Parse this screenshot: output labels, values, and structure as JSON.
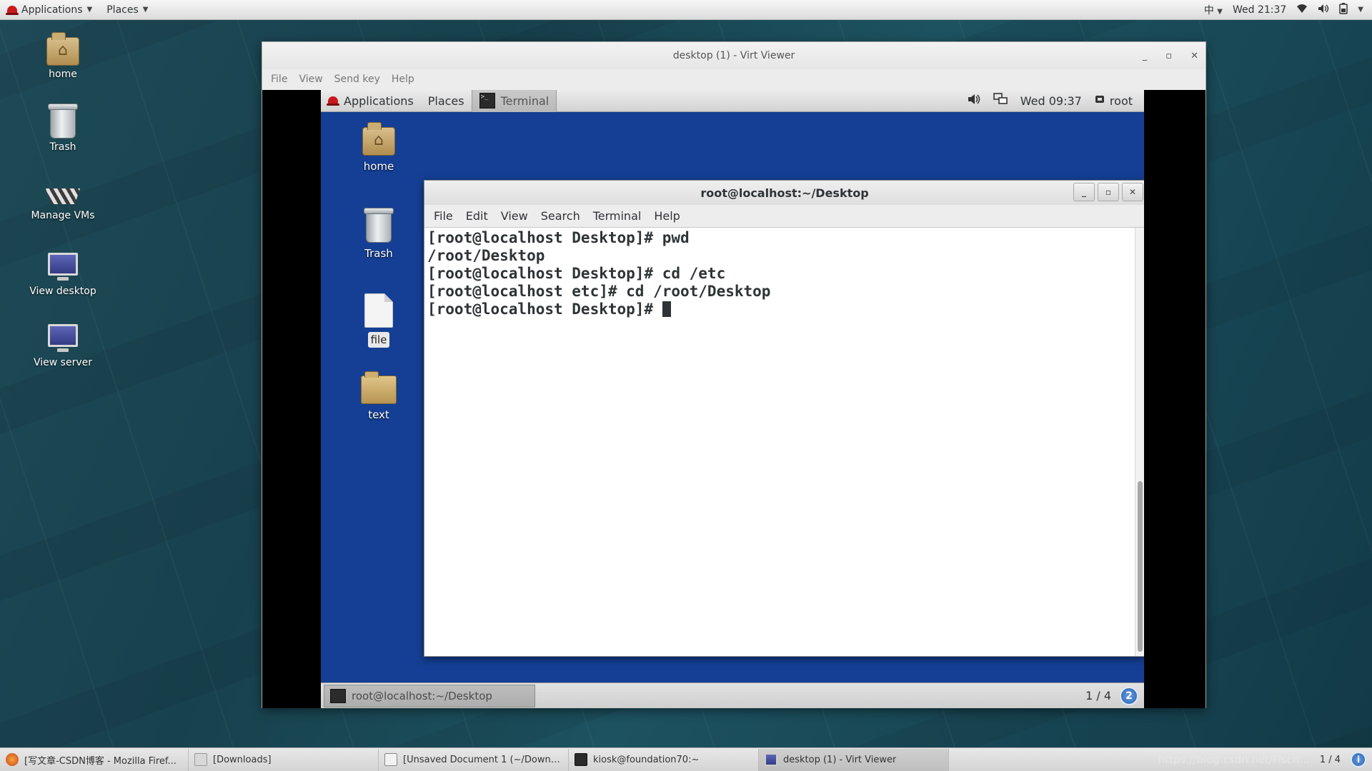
{
  "host_panel": {
    "applications": "Applications",
    "places": "Places",
    "input_method": "中",
    "clock": "Wed 21:37"
  },
  "host_desktop": {
    "icons": [
      "home",
      "Trash",
      "Manage VMs",
      "View desktop",
      "View server"
    ]
  },
  "virt_viewer": {
    "title": "desktop (1) - Virt Viewer",
    "menu": [
      "File",
      "View",
      "Send key",
      "Help"
    ]
  },
  "guest_panel": {
    "applications": "Applications",
    "places": "Places",
    "terminal_tab": "Terminal",
    "clock": "Wed 09:37",
    "user": "root"
  },
  "guest_desktop": {
    "icons": [
      "home",
      "Trash",
      "file",
      "text"
    ]
  },
  "terminal": {
    "title": "root@localhost:~/Desktop",
    "menu": [
      "File",
      "Edit",
      "View",
      "Search",
      "Terminal",
      "Help"
    ],
    "lines": [
      "[root@localhost Desktop]# pwd",
      "/root/Desktop",
      "[root@localhost Desktop]# cd /etc",
      "[root@localhost etc]# cd /root/Desktop",
      "[root@localhost Desktop]# "
    ]
  },
  "guest_bottom": {
    "task": "root@localhost:~/Desktop",
    "pager": "1 / 4",
    "help_badge": "2"
  },
  "host_taskbar": {
    "items": [
      "[写文章-CSDN博客 - Mozilla Firef...",
      "[Downloads]",
      "[Unsaved Document 1 (~/Downlo...",
      "kiosk@foundation70:~",
      "desktop (1) - Virt Viewer"
    ],
    "watermark": "https://blog.csdn.net/Fisch...",
    "pager": "1 / 4"
  }
}
